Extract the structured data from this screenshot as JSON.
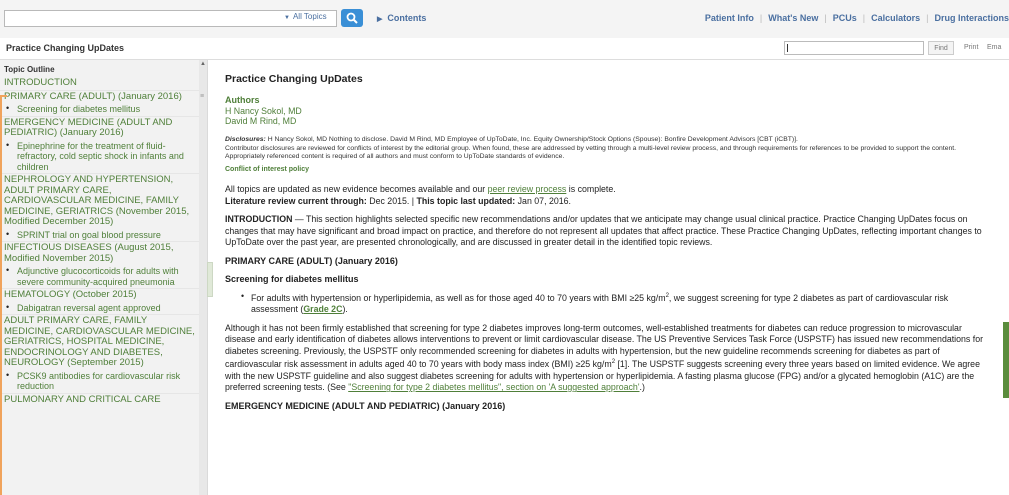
{
  "topbar": {
    "search_placeholder": "",
    "topics_dropdown": "All Topics",
    "contents_label": "Contents",
    "nav": [
      "Patient Info",
      "What's New",
      "PCUs",
      "Calculators",
      "Drug Interactions"
    ]
  },
  "subbar": {
    "title": "Practice Changing UpDates",
    "find_label": "Find",
    "print_label": "Print",
    "email_label": "Ema"
  },
  "sidebar": {
    "heading": "Topic Outline",
    "items": [
      {
        "type": "sec",
        "text": "INTRODUCTION"
      },
      {
        "type": "sec",
        "text": "PRIMARY CARE (ADULT) (January 2016)"
      },
      {
        "type": "sub",
        "text": "Screening for diabetes mellitus"
      },
      {
        "type": "sec",
        "text": "EMERGENCY MEDICINE (ADULT AND PEDIATRIC) (January 2016)"
      },
      {
        "type": "sub",
        "text": "Epinephrine for the treatment of fluid-refractory, cold septic shock in infants and children"
      },
      {
        "type": "sec",
        "text": "NEPHROLOGY AND HYPERTENSION, ADULT PRIMARY CARE, CARDIOVASCULAR MEDICINE, FAMILY MEDICINE, GERIATRICS (November 2015, Modified December 2015)"
      },
      {
        "type": "sub",
        "text": "SPRINT trial on goal blood pressure"
      },
      {
        "type": "sec",
        "text": "INFECTIOUS DISEASES (August 2015, Modified November 2015)"
      },
      {
        "type": "sub",
        "text": "Adjunctive glucocorticoids for adults with severe community-acquired pneumonia"
      },
      {
        "type": "sec",
        "text": "HEMATOLOGY (October 2015)"
      },
      {
        "type": "sub",
        "text": "Dabigatran reversal agent approved"
      },
      {
        "type": "sec",
        "text": "ADULT PRIMARY CARE, FAMILY MEDICINE, CARDIOVASCULAR MEDICINE, GERIATRICS, HOSPITAL MEDICINE, ENDOCRINOLOGY AND DIABETES, NEUROLOGY (September 2015)"
      },
      {
        "type": "sub",
        "text": "PCSK9 antibodies for cardiovascular risk reduction"
      },
      {
        "type": "sec",
        "text": "PULMONARY AND CRITICAL CARE"
      }
    ]
  },
  "main": {
    "title": "Practice Changing UpDates",
    "authors_heading": "Authors",
    "authors": [
      "H Nancy Sokol, MD",
      "David M Rind, MD"
    ],
    "disclosures_label": "Disclosures:",
    "disclosures_text": " H Nancy Sokol, MD Nothing to disclose. David M Rind, MD Employee of UpToDate, Inc. Equity Ownership/Stock Options (Spouse): Bonfire Development Advisors [CBT (iCBT)].",
    "contributor_text": "Contributor disclosures are reviewed for conflicts of interest by the editorial group. When found, these are addressed by vetting through a multi-level review process, and through requirements for references to be provided to support the content. Appropriately referenced content is required of all authors and must conform to UpToDate standards of evidence.",
    "coi_link": "Conflict of interest policy",
    "updates_pre": "All topics are updated as new evidence becomes available and our ",
    "updates_link": "peer review process",
    "updates_post": " is complete.",
    "lit_review_label": "Literature review current through:",
    "lit_review_date": " Dec 2015. | ",
    "last_updated_label": "This topic last updated:",
    "last_updated_date": " Jan 07, 2016.",
    "intro_label": "INTRODUCTION",
    "intro_text": " — This section highlights selected specific new recommendations and/or updates that we anticipate may change usual clinical practice. Practice Changing UpDates focus on changes that may have significant and broad impact on practice, and therefore do not represent all updates that affect practice. These Practice Changing UpDates, reflecting important changes to UpToDate over the past year, are presented chronologically, and are discussed in greater detail in the identified topic reviews.",
    "primary_care_heading": "PRIMARY CARE (ADULT) (January 2016)",
    "screening_heading": "Screening for diabetes mellitus",
    "bullet_text_1": "For adults with hypertension or hyperlipidemia, as well as for those aged 40 to 70 years with BMI ≥25 kg/m",
    "bullet_sup": "2",
    "bullet_text_2": ", we suggest screening for type 2 diabetes as part of cardiovascular risk assessment (",
    "grade_link": "Grade 2C",
    "bullet_end": ").",
    "para_1": "Although it has not been firmly established that screening for type 2 diabetes improves long-term outcomes, well-established treatments for diabetes can reduce progression to microvascular disease and early identification of diabetes allows interventions to prevent or limit cardiovascular disease. The US Preventive Services Task Force (USPSTF) has issued new recommendations for diabetes screening. Previously, the USPSTF only recommended screening for diabetes in adults with hypertension, but the new guideline recommends screening for diabetes as part of cardiovascular risk assessment in adults aged 40 to 70 years with body mass index (BMI) ≥25 kg/m",
    "para_1_sup": "2",
    "para_1b": " [1]. The USPSTF suggests screening every three years based on limited evidence. We agree with the new USPSTF guideline and also suggest diabetes screening for adults with hypertension or hyperlipidemia. A fasting plasma glucose (FPG) and/or a glycated hemoglobin (A1C) are the preferred screening tests. (See ",
    "para_1_link": "\"Screening for type 2 diabetes mellitus\", section on 'A suggested approach'",
    "para_1_end": ".)",
    "emergency_heading": "EMERGENCY MEDICINE (ADULT AND PEDIATRIC) (January 2016)"
  },
  "colors": {
    "accent_green": "#4f7f39",
    "search_blue": "#3a8fd6",
    "nav_blue": "#4a6fa0",
    "bracket_orange": "#f0a35c"
  }
}
